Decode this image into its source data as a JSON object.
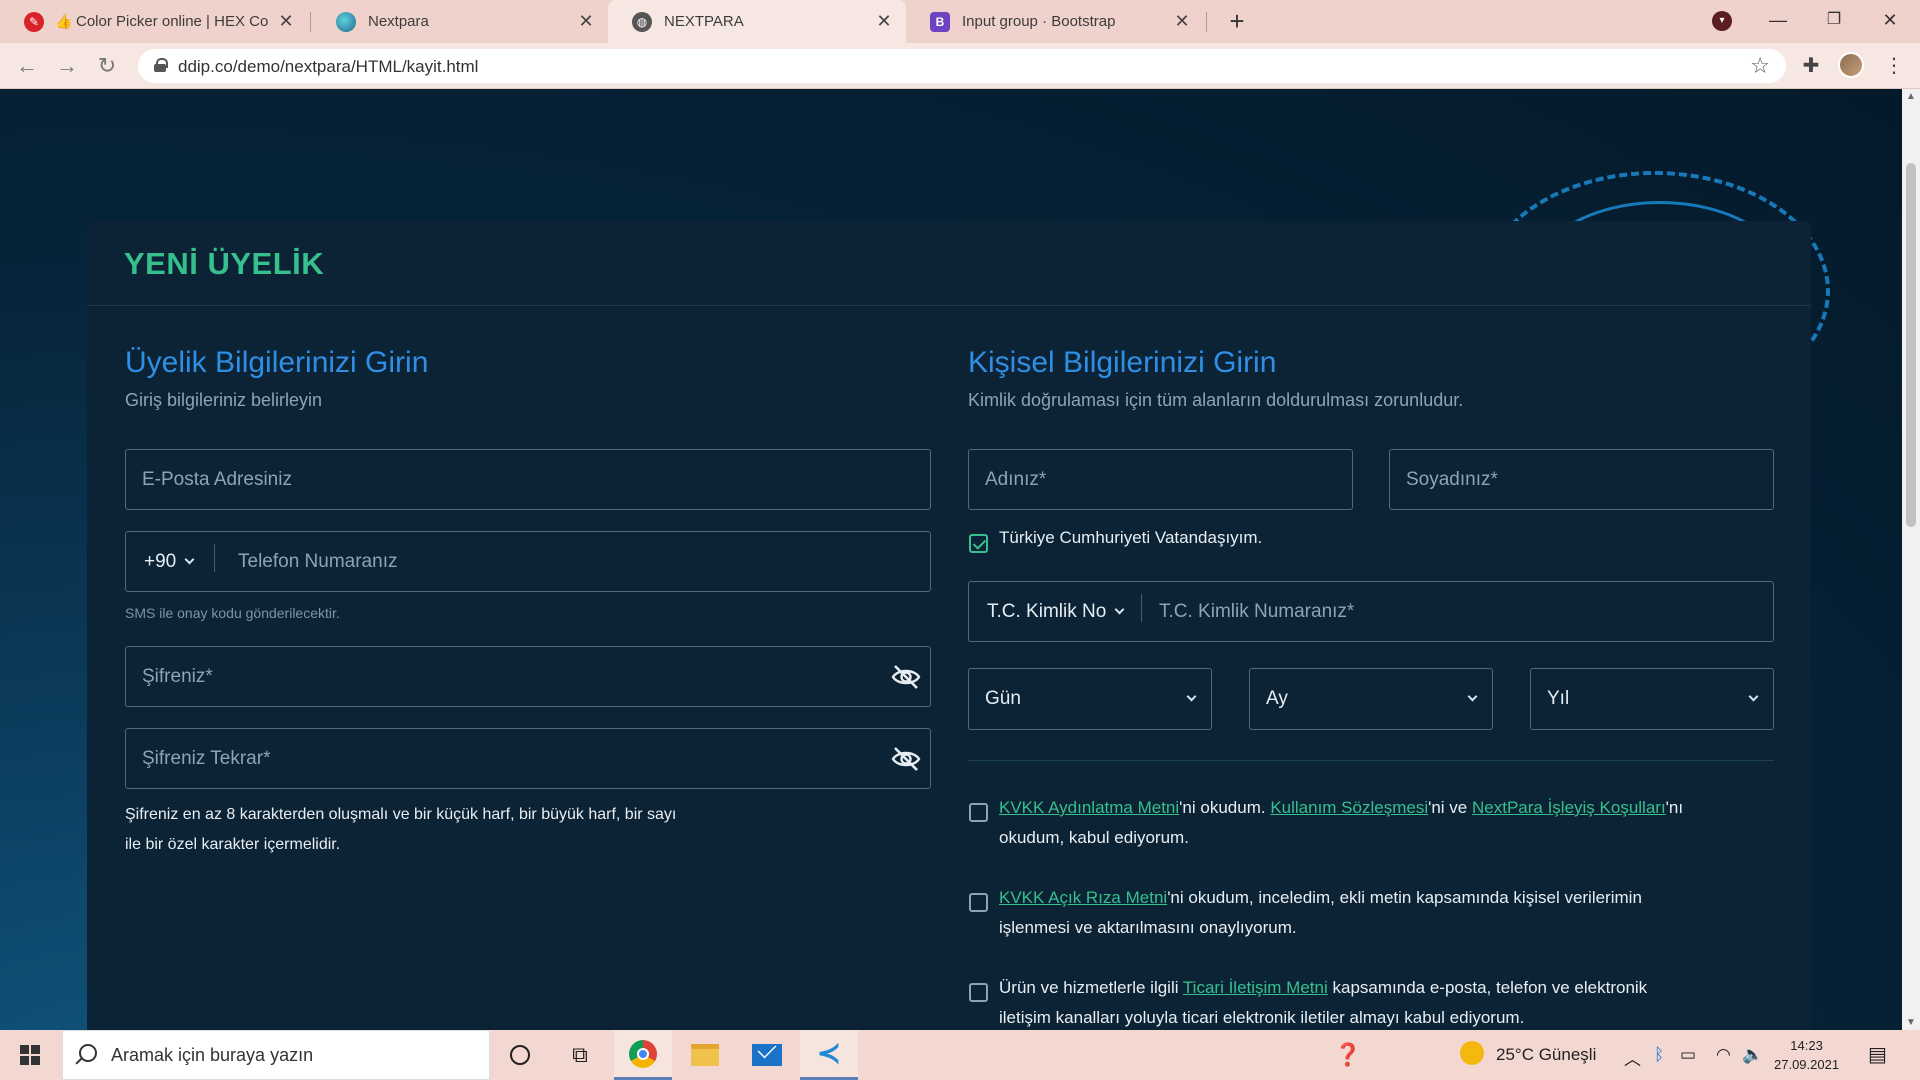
{
  "browser": {
    "tabs": [
      {
        "title": "Color Picker online | HEX Colo",
        "icon": "colorpicker-favicon-icon"
      },
      {
        "title": "Nextpara",
        "icon": "globe-favicon-icon"
      },
      {
        "title": "NEXTPARA",
        "icon": "world-favicon-icon",
        "active": true
      },
      {
        "title": "Input group · Bootstrap",
        "icon": "bootstrap-favicon-icon",
        "favicon_letter": "B"
      }
    ],
    "url": "ddip.co/demo/nextpara/HTML/kayit.html"
  },
  "card": {
    "title": "YENİ ÜYELİK"
  },
  "left": {
    "title": "Üyelik Bilgilerinizi Girin",
    "subtitle": "Giriş bilgileriniz belirleyin",
    "email_placeholder": "E-Posta Adresiniz",
    "phone_code": "+90",
    "phone_placeholder": "Telefon Numaranız",
    "sms_helper": "SMS ile onay kodu gönderilecektir.",
    "password_placeholder": "Şifreniz*",
    "password_repeat_placeholder": "Şifreniz Tekrar*",
    "password_note_1": "Şifreniz en az 8 karakterden oluşmalı ve bir küçük harf, bir büyük harf, bir sayı",
    "password_note_2": "ile bir özel karakter içermelidir."
  },
  "right": {
    "title": "Kişisel Bilgilerinizi Girin",
    "subtitle": "Kimlik doğrulaması için tüm alanların doldurulması zorunludur.",
    "name_placeholder": "Adınız*",
    "surname_placeholder": "Soyadınız*",
    "citizen_label": "Türkiye Cumhuriyeti Vatandaşıyım.",
    "citizen_checked": true,
    "id_type": "T.C. Kimlik No",
    "id_placeholder": "T.C. Kimlik Numaranız*",
    "day": "Gün",
    "month": "Ay",
    "year": "Yıl",
    "consents": {
      "kvkk": {
        "link1": "KVKK Aydınlatma Metni",
        "text1": "'ni okudum. ",
        "link2": "Kullanım Sözleşmesi",
        "text2": "'ni ve ",
        "link3": "NextPara İşleyiş Koşulları",
        "text3": "'nı",
        "line2": "okudum, kabul ediyorum."
      },
      "rıza": {
        "link1": "KVKK Açık Rıza Metni",
        "text1": "'ni okudum, inceledim, ekli metin kapsamında kişisel verilerimin",
        "line2": "işlenmesi ve aktarılmasını onaylıyorum."
      },
      "ticari": {
        "text0": "Ürün ve hizmetlerle ilgili ",
        "link1": "Ticari İletişim Metni",
        "text1": " kapsamında e-posta, telefon ve elektronik",
        "line2": "iletişim kanalları yoluyla ticari elektronik iletiler almayı kabul ediyorum."
      }
    }
  },
  "taskbar": {
    "search_placeholder": "Aramak için buraya yazın",
    "weather": "25°C  Güneşli",
    "time": "14:23",
    "date": "27.09.2021"
  },
  "colors": {
    "accent_green": "#35c08d",
    "accent_blue": "#2f8fe6",
    "card_bg": "#0b2334"
  }
}
